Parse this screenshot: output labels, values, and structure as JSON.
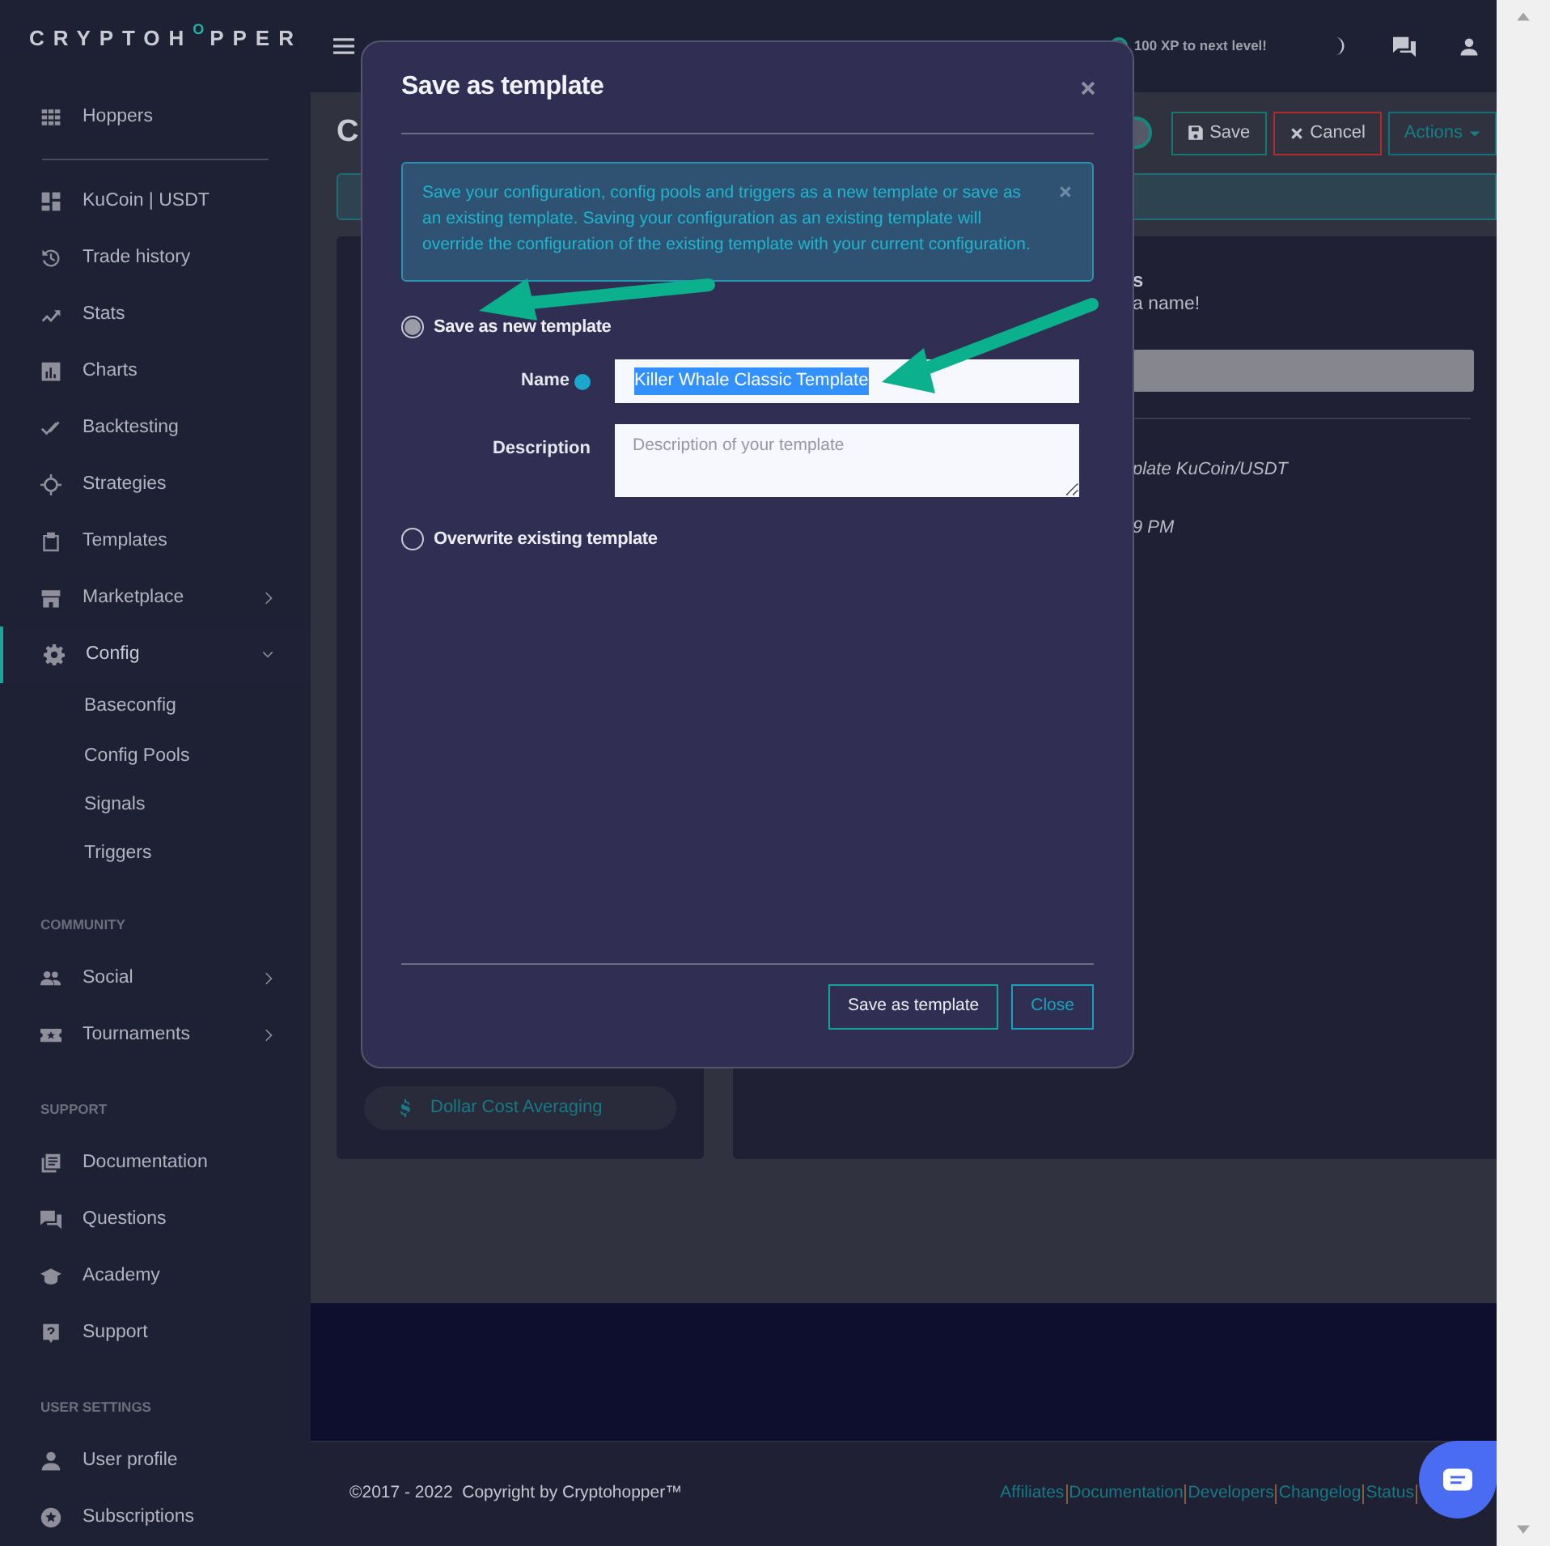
{
  "logo": {
    "parts": [
      "CRYPTOH",
      "O",
      "PPER"
    ]
  },
  "topbar": {
    "xp_text": "100 XP to next level!"
  },
  "sidebar": {
    "sections": [
      {
        "items": [
          {
            "label": "Hoppers",
            "selected": false
          }
        ]
      },
      {
        "items": [
          {
            "label": "KuCoin | USDT",
            "selected": false
          },
          {
            "label": "Trade history",
            "selected": false
          },
          {
            "label": "Stats",
            "selected": false
          },
          {
            "label": "Charts",
            "selected": false
          },
          {
            "label": "Backtesting",
            "selected": false
          },
          {
            "label": "Strategies",
            "selected": false
          },
          {
            "label": "Templates",
            "selected": false
          },
          {
            "label": "Marketplace",
            "selected": false,
            "expanded": false
          },
          {
            "label": "Config",
            "selected": true,
            "expanded": true,
            "children": [
              {
                "label": "Baseconfig"
              },
              {
                "label": "Config Pools"
              },
              {
                "label": "Signals"
              },
              {
                "label": "Triggers"
              }
            ]
          }
        ]
      },
      {
        "title": "COMMUNITY",
        "items": [
          {
            "label": "Social",
            "selected": false,
            "expanded": false
          },
          {
            "label": "Tournaments",
            "selected": false,
            "expanded": false
          }
        ]
      },
      {
        "title": "SUPPORT",
        "items": [
          {
            "label": "Documentation",
            "selected": false
          },
          {
            "label": "Questions",
            "selected": false
          },
          {
            "label": "Academy",
            "selected": false
          },
          {
            "label": "Support",
            "selected": false
          }
        ]
      },
      {
        "title": "USER SETTINGS",
        "items": [
          {
            "label": "User profile",
            "selected": false
          },
          {
            "label": "Subscriptions",
            "selected": false
          }
        ]
      }
    ]
  },
  "page": {
    "title": "C",
    "toggle": {
      "on": true
    },
    "buttons": [
      {
        "label": "Save",
        "kind": "save"
      },
      {
        "label": "Cancel",
        "kind": "cancel"
      },
      {
        "label": "Actions",
        "kind": "dropdown"
      }
    ]
  },
  "left_card": {
    "items": [
      {
        "label": "Dollar Cost Averaging"
      }
    ]
  },
  "right_card": {
    "text_1": "s",
    "text_2": "a name!",
    "text_3": "plate KuCoin/USDT",
    "text_4": "9 PM"
  },
  "modal": {
    "title": "Save as template",
    "alert": "Save your configuration, config pools and triggers as a new template or save as an existing template. Saving your configuration as an existing template will override the configuration of the existing template with your current configuration.",
    "options": [
      {
        "label": "Save as new template",
        "selected": true
      },
      {
        "label": "Overwrite existing template",
        "selected": false
      }
    ],
    "name_field": {
      "label": "Name",
      "value": "Killer Whale Classic Template",
      "value_selected": true
    },
    "description_field": {
      "label": "Description",
      "placeholder": "Description of your template"
    },
    "buttons": [
      {
        "label": "Save as template",
        "kind": "primary"
      },
      {
        "label": "Close",
        "kind": "secondary"
      }
    ]
  },
  "footer": {
    "copyright": "©2017 - 2022  Copyright by Cryptohopper™",
    "links": [
      "Affiliates",
      "Documentation",
      "Developers",
      "Changelog",
      "Status"
    ]
  }
}
